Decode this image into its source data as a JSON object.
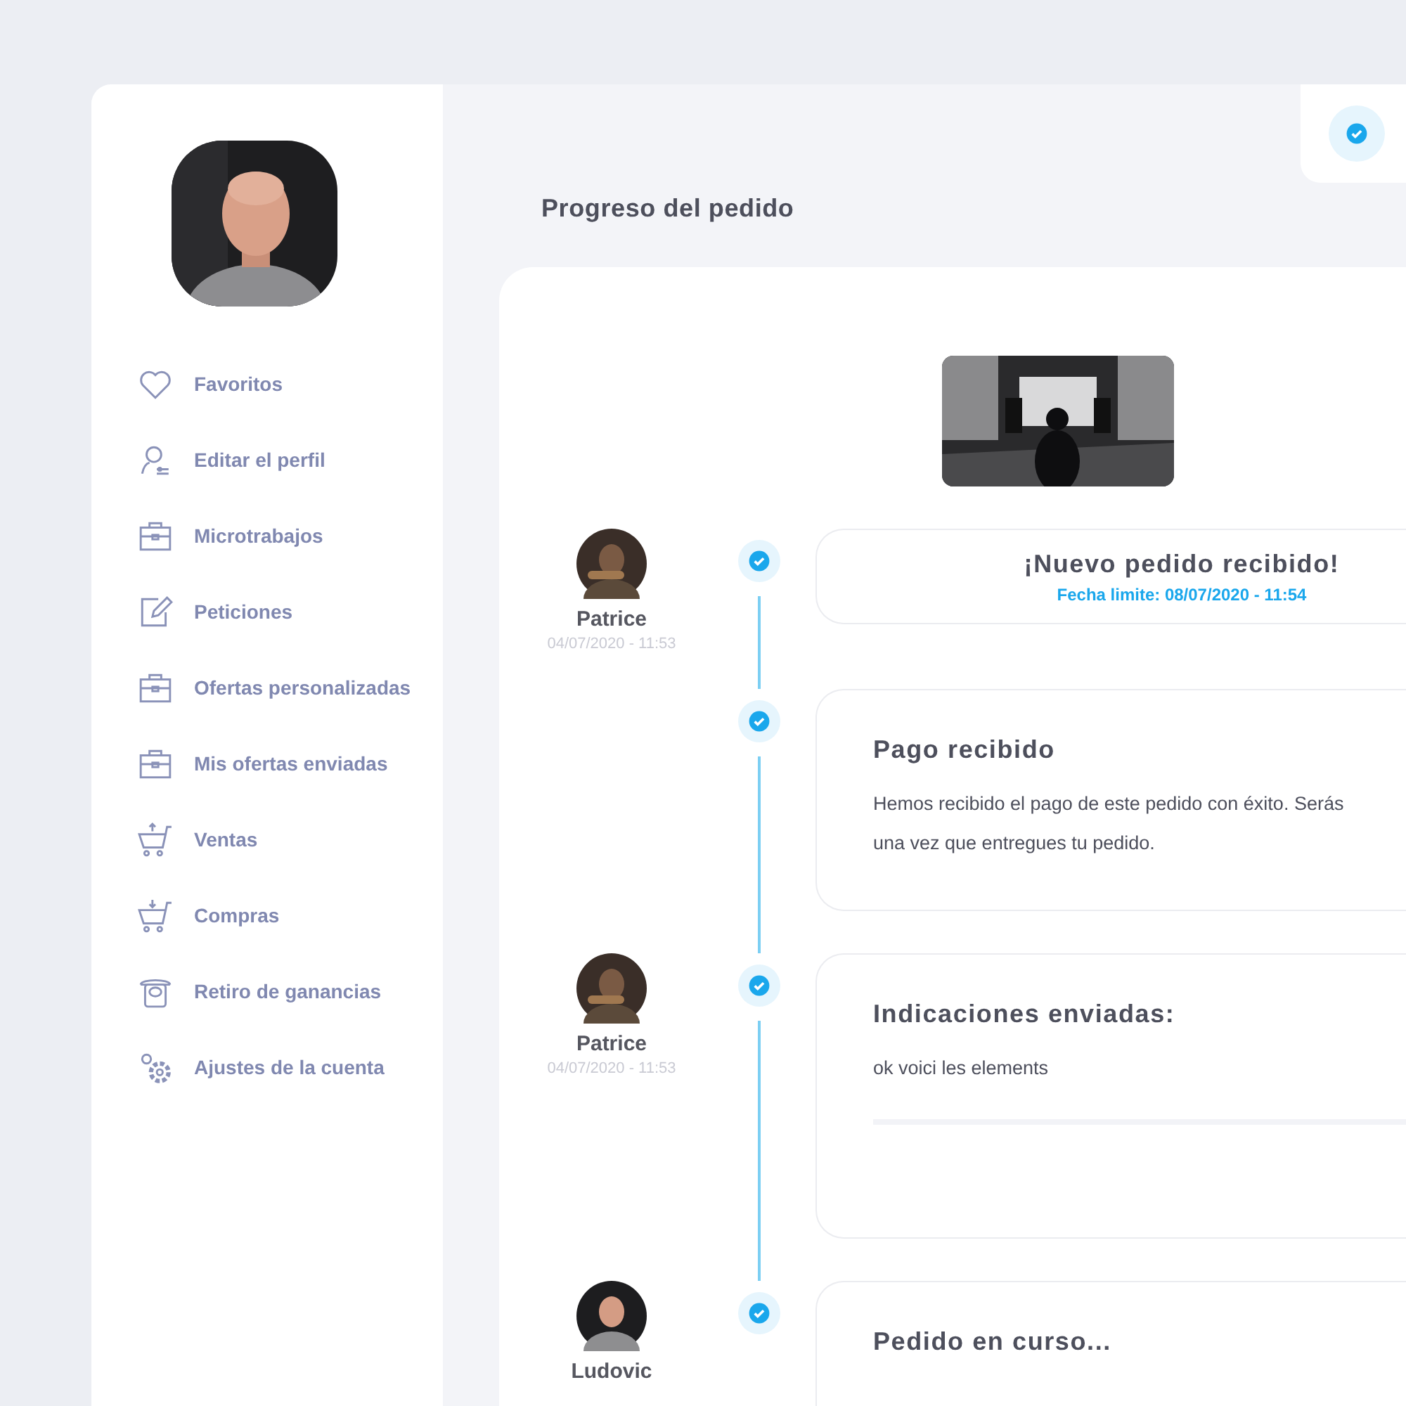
{
  "sidebar": {
    "items": [
      {
        "label": "Favoritos"
      },
      {
        "label": "Editar el perfil"
      },
      {
        "label": "Microtrabajos"
      },
      {
        "label": "Peticiones"
      },
      {
        "label": "Ofertas personalizadas"
      },
      {
        "label": "Mis ofertas enviadas"
      },
      {
        "label": "Ventas"
      },
      {
        "label": "Compras"
      },
      {
        "label": "Retiro de ganancias"
      },
      {
        "label": "Ajustes de la cuenta"
      }
    ]
  },
  "page_title": "Progreso del pedido",
  "timeline": [
    {
      "kind": "header",
      "author": {
        "name": "Patrice",
        "date": "04/07/2020 - 11:53"
      },
      "title": "¡Nuevo pedido recibido!",
      "deadline": "Fecha limite: 08/07/2020 - 11:54"
    },
    {
      "kind": "message",
      "title": "Pago recibido",
      "lines": [
        "Hemos recibido el pago de este pedido con éxito. Serás",
        "una vez que entregues tu pedido."
      ]
    },
    {
      "kind": "message",
      "author": {
        "name": "Patrice",
        "date": "04/07/2020 - 11:53"
      },
      "title": "Indicaciones enviadas:",
      "lines": [
        "ok voici les elements"
      ],
      "divider": true
    },
    {
      "kind": "message",
      "author": {
        "name": "Ludovic"
      },
      "title": "Pedido en curso..."
    }
  ]
}
